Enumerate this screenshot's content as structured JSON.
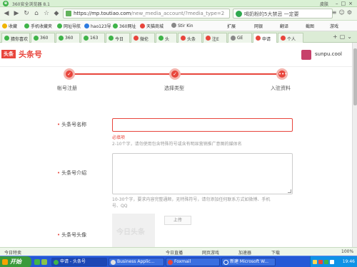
{
  "browser": {
    "title": "360安全浏览器 8.1",
    "title_right": "皮肤",
    "url_host": "https://mp.toutiao.com",
    "url_path": "/new_media_account/?media_type=2",
    "search_text": "喝奶粉的5大禁忌 一定要",
    "colors": {
      "chrome_green": "#3fb449",
      "accent_red": "#e8453c"
    }
  },
  "bookmarks": [
    {
      "label": "收藏",
      "color": "#f0b400"
    },
    {
      "label": "手机收藏夹",
      "color": "#3fb449"
    },
    {
      "label": "网址导航",
      "color": "#3fb449"
    },
    {
      "label": "hao123导",
      "color": "#2d7be0"
    },
    {
      "label": "360网址",
      "color": "#3fb449"
    },
    {
      "label": "天猫商城",
      "color": "#e8453c"
    },
    {
      "label": "Stir Kin",
      "color": "#888888"
    }
  ],
  "bookmarks_right": [
    "扩展",
    "网银",
    "翻译",
    "截图",
    "游戏"
  ],
  "tabs": [
    {
      "label": "猜你喜欢",
      "color": "#3fb449",
      "active": false
    },
    {
      "label": "360",
      "color": "#3fb449",
      "active": false
    },
    {
      "label": "360",
      "color": "#3fb449",
      "active": false
    },
    {
      "label": "163",
      "color": "#3fb449",
      "active": false
    },
    {
      "label": "今日",
      "color": "#3fb449",
      "active": false
    },
    {
      "label": "微伦",
      "color": "#e8453c",
      "active": false
    },
    {
      "label": "头",
      "color": "#3fb449",
      "active": false
    },
    {
      "label": "头条",
      "color": "#e8453c",
      "active": false
    },
    {
      "label": "注E",
      "color": "#e8453c",
      "active": false
    },
    {
      "label": "GE",
      "color": "#888888",
      "active": false
    },
    {
      "label": "申请",
      "color": "#e8453c",
      "active": true
    },
    {
      "label": "个人",
      "color": "#e8453c",
      "active": false
    }
  ],
  "site": {
    "logo_text": "头条",
    "brand_name": "头条号",
    "username": "sunpu.cool"
  },
  "steps": [
    {
      "label": "帐号注册"
    },
    {
      "label": "选择类型"
    },
    {
      "label": "入驻资料"
    }
  ],
  "form": {
    "name_label": "头条号名称",
    "name_value": "",
    "name_error": "必填项",
    "name_hint": "2-10个字，请勿使用包含特殊符号或含有明显营销推广意图的媒体名",
    "intro_label": "头条号介绍",
    "intro_value": "",
    "intro_hint_1": "10-30个字，要求内容完整通顺，无特殊符号，请勿添加任何联系方式如微博、手机",
    "intro_hint_2": "号、QQ",
    "avatar_label": "头条号头像",
    "avatar_placeholder": "今日头条",
    "upload_label": "上传"
  },
  "statusbar": {
    "left": "今日特卖",
    "items": [
      "今日直播",
      "网页游戏",
      "加速器",
      "下载"
    ],
    "zoom": "100%"
  },
  "taskbar": {
    "start_label": "开始",
    "tasks": [
      {
        "label": "申请 - 头条号",
        "active": true
      },
      {
        "label": "Business Applic...",
        "active": false
      },
      {
        "label": "Foxmail",
        "active": false
      },
      {
        "label": "新建 Microsoft W...",
        "active": false
      }
    ],
    "clock": "19:46"
  }
}
